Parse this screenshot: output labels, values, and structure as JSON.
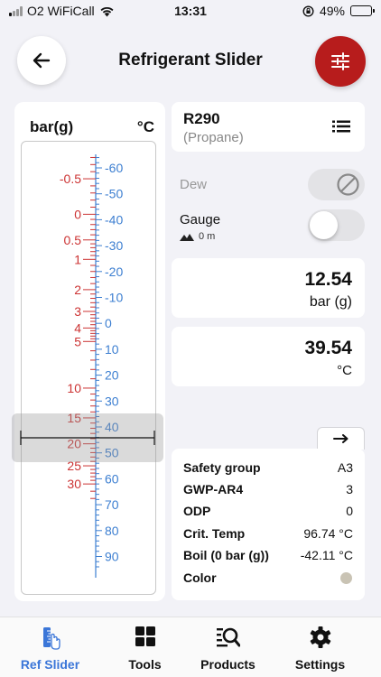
{
  "status_bar": {
    "carrier": "O2 WiFiCall",
    "time": "13:31",
    "battery": "49%",
    "battery_level": 0.49
  },
  "header": {
    "title": "Refrigerant Slider"
  },
  "slider": {
    "left_unit": "bar(g)",
    "right_unit": "°C",
    "pressure_labels": [
      "-0.5",
      "0",
      "0.5",
      "1",
      "2",
      "3",
      "4",
      "5",
      "10",
      "15",
      "20",
      "25",
      "30"
    ],
    "temperature_labels": [
      "-60",
      "-50",
      "-40",
      "-30",
      "-20",
      "-10",
      "0",
      "10",
      "20",
      "30",
      "40",
      "50",
      "60",
      "70",
      "80",
      "90"
    ],
    "pressure_color": "#cc3333",
    "temperature_color": "#3d7fd1"
  },
  "refrigerant": {
    "name": "R290",
    "subtitle": "(Propane)"
  },
  "dew": {
    "label": "Dew",
    "enabled": false
  },
  "gauge": {
    "label": "Gauge",
    "altitude": "0 m",
    "on": false
  },
  "pressure": {
    "value": "12.54",
    "unit": "bar (g)"
  },
  "temperature": {
    "value": "39.54",
    "unit": "°C"
  },
  "properties": [
    {
      "key": "Safety group",
      "value": "A3"
    },
    {
      "key": "GWP-AR4",
      "value": "3"
    },
    {
      "key": "ODP",
      "value": "0"
    },
    {
      "key": "Crit. Temp",
      "value": "96.74 °C"
    },
    {
      "key": "Boil (0 bar (g))",
      "value": "-42.11 °C"
    },
    {
      "key": "Color",
      "value": ""
    }
  ],
  "tabs": [
    {
      "label": "Ref Slider",
      "icon": "ruler-hand-icon",
      "active": true
    },
    {
      "label": "Tools",
      "icon": "grid-icon",
      "active": false
    },
    {
      "label": "Products",
      "icon": "search-list-icon",
      "active": false
    },
    {
      "label": "Settings",
      "icon": "gear-icon",
      "active": false
    }
  ],
  "colors": {
    "accent_red": "#b71c1c",
    "active_tab": "#3b76d8"
  }
}
